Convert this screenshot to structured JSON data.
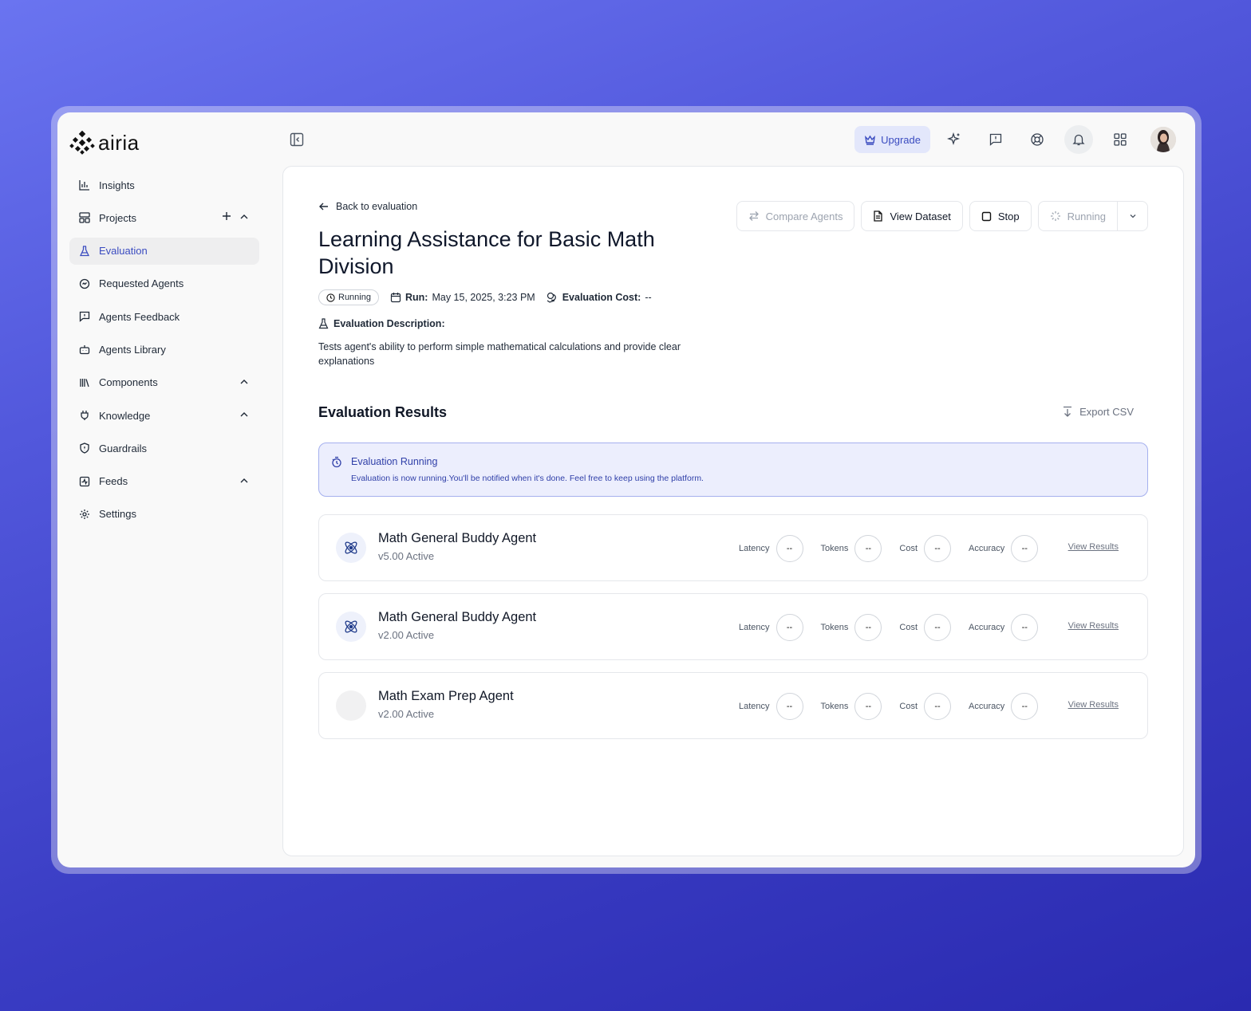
{
  "brand": {
    "name": "airia"
  },
  "sidebar": {
    "items": [
      {
        "label": "Insights",
        "icon": "bar-chart-icon"
      },
      {
        "label": "Projects",
        "icon": "layout-icon"
      },
      {
        "label": "Evaluation",
        "icon": "flask-icon"
      },
      {
        "label": "Requested Agents",
        "icon": "chat-icon"
      },
      {
        "label": "Agents Feedback",
        "icon": "feedback-icon"
      },
      {
        "label": "Agents Library",
        "icon": "robot-icon"
      },
      {
        "label": "Components",
        "icon": "library-icon"
      },
      {
        "label": "Knowledge",
        "icon": "plug-icon"
      },
      {
        "label": "Guardrails",
        "icon": "shield-icon"
      },
      {
        "label": "Feeds",
        "icon": "activity-icon"
      },
      {
        "label": "Settings",
        "icon": "gear-icon"
      }
    ]
  },
  "topbar": {
    "upgrade_label": "Upgrade"
  },
  "page": {
    "back_label": "Back to evaluation",
    "title": "Learning Assistance for Basic Math Division",
    "status": "Running",
    "run_label": "Run:",
    "run_value": "May 15, 2025, 3:23 PM",
    "cost_label": "Evaluation Cost:",
    "cost_value": "--",
    "description_label": "Evaluation Description:",
    "description": "Tests agent's ability to perform simple mathematical calculations and provide clear explanations"
  },
  "actions": {
    "compare": "Compare Agents",
    "view_dataset": "View Dataset",
    "stop": "Stop",
    "running": "Running"
  },
  "results": {
    "title": "Evaluation Results",
    "export": "Export CSV",
    "alert_title": "Evaluation Running",
    "alert_text": "Evaluation is now running.You'll be notified when it's done. Feel free to keep using the platform.",
    "metric_labels": {
      "latency": "Latency",
      "tokens": "Tokens",
      "cost": "Cost",
      "accuracy": "Accuracy"
    },
    "view_results": "View Results",
    "agents": [
      {
        "name": "Math General Buddy Agent",
        "version": "v5.00 Active",
        "latency": "--",
        "tokens": "--",
        "cost": "--",
        "accuracy": "--"
      },
      {
        "name": "Math General Buddy Agent",
        "version": "v2.00 Active",
        "latency": "--",
        "tokens": "--",
        "cost": "--",
        "accuracy": "--"
      },
      {
        "name": "Math Exam Prep Agent",
        "version": "v2.00 Active",
        "latency": "--",
        "tokens": "--",
        "cost": "--",
        "accuracy": "--"
      }
    ]
  },
  "colors": {
    "accent": "#3b4cc0",
    "alert_bg": "#eceefd",
    "upgrade_bg": "#e3e7fb"
  }
}
